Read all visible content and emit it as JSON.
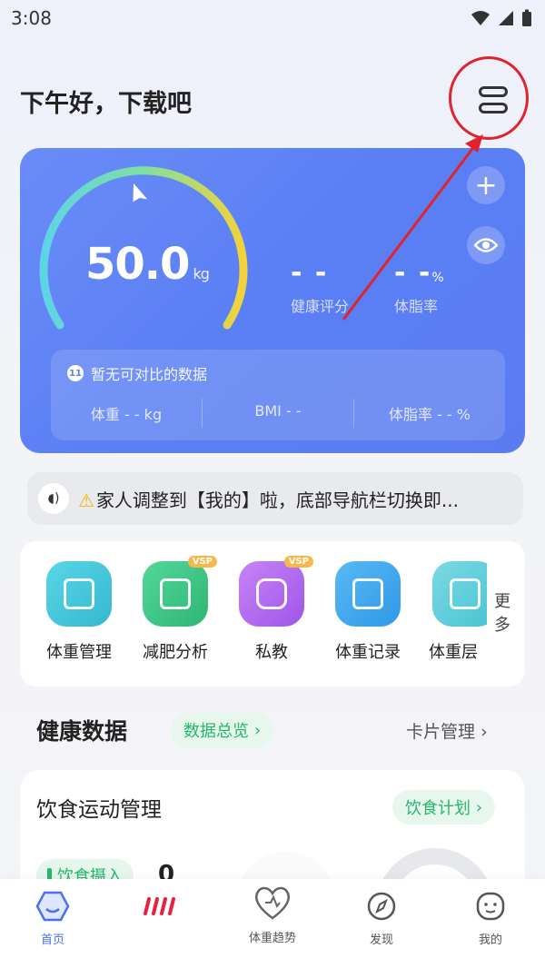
{
  "status_bar": {
    "time": "3:08"
  },
  "header": {
    "greeting": "下午好，下载吧"
  },
  "weight_card": {
    "weight_value": "50.0",
    "weight_unit": "kg",
    "health_score_value": "- -",
    "health_score_label": "健康评分",
    "body_fat_value": "- -",
    "body_fat_unit": "%",
    "body_fat_label": "体脂率",
    "gauge_fraction": 0.5,
    "compare": {
      "title": "暂无可对比的数据",
      "weight": "体重 - - kg",
      "bmi": "BMI - -",
      "body_fat": "体脂率 - - %"
    }
  },
  "notice": {
    "text": "家人调整到【我的】啦，底部导航栏切换即..."
  },
  "features": {
    "items": [
      {
        "label": "体重管理",
        "color": "#3fc1d8",
        "vip": ""
      },
      {
        "label": "减肥分析",
        "color": "#39c486",
        "vip": "VSP"
      },
      {
        "label": "私教",
        "color": "#b26cf0",
        "vip": "VSP"
      },
      {
        "label": "体重记录",
        "color": "#3aa8ef",
        "vip": ""
      },
      {
        "label": "体重层",
        "color": "#4cc9d6",
        "vip": ""
      }
    ],
    "more": "更多"
  },
  "health_section": {
    "title": "健康数据",
    "overview": "数据总览",
    "manage": "卡片管理"
  },
  "diet_card": {
    "title": "饮食运动管理",
    "plan": "饮食计划",
    "intake_label": "饮食摄入",
    "intake_value": "0"
  },
  "tabbar": {
    "items": [
      {
        "label": "首页"
      },
      {
        "label": ""
      },
      {
        "label": "体重趋势"
      },
      {
        "label": "发现"
      },
      {
        "label": "我的"
      }
    ]
  },
  "colors": {
    "accent": "#5b7ff4",
    "green": "#24b86a",
    "annotation_red": "#e0242c"
  }
}
